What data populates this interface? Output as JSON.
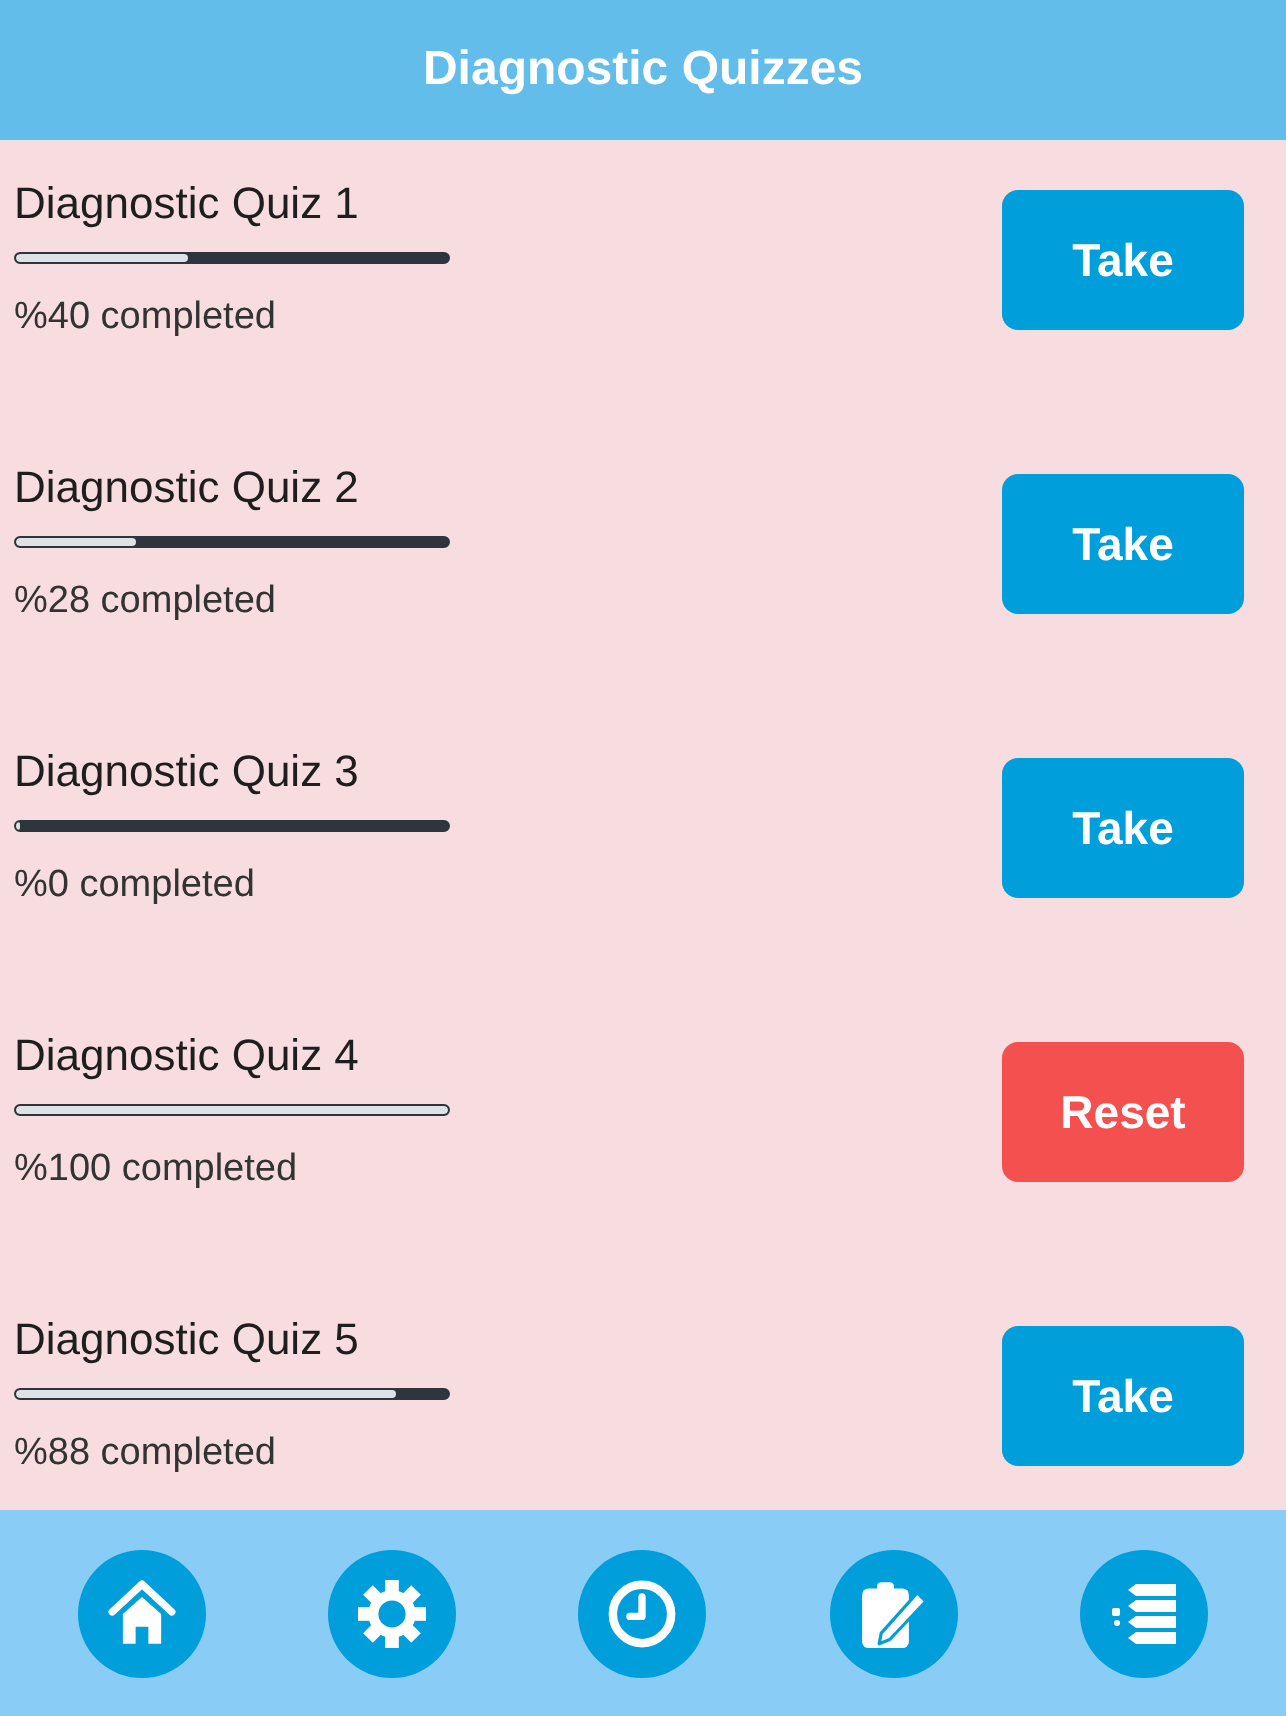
{
  "header": {
    "title": "Diagnostic Quizzes"
  },
  "quizzes": [
    {
      "title": "Diagnostic Quiz 1",
      "level": 0.4,
      "progress_text": "%40 completed",
      "button": {
        "label": "Take",
        "kind": "take"
      }
    },
    {
      "title": "Diagnostic Quiz 2",
      "level": 0.28,
      "progress_text": "%28 completed",
      "button": {
        "label": "Take",
        "kind": "take"
      }
    },
    {
      "title": "Diagnostic Quiz 3",
      "level": 0,
      "progress_text": "%0 completed",
      "button": {
        "label": "Take",
        "kind": "take"
      }
    },
    {
      "title": "Diagnostic Quiz 4",
      "level": 1,
      "progress_text": "%100 completed",
      "button": {
        "label": "Reset",
        "kind": "reset"
      }
    },
    {
      "title": "Diagnostic Quiz 5",
      "level": 0.88,
      "progress_text": "%88 completed",
      "button": {
        "label": "Take",
        "kind": "take"
      }
    }
  ],
  "nav": [
    {
      "kind": "home"
    },
    {
      "kind": "settings"
    },
    {
      "kind": "clock"
    },
    {
      "kind": "notes"
    },
    {
      "kind": "quiz"
    }
  ]
}
